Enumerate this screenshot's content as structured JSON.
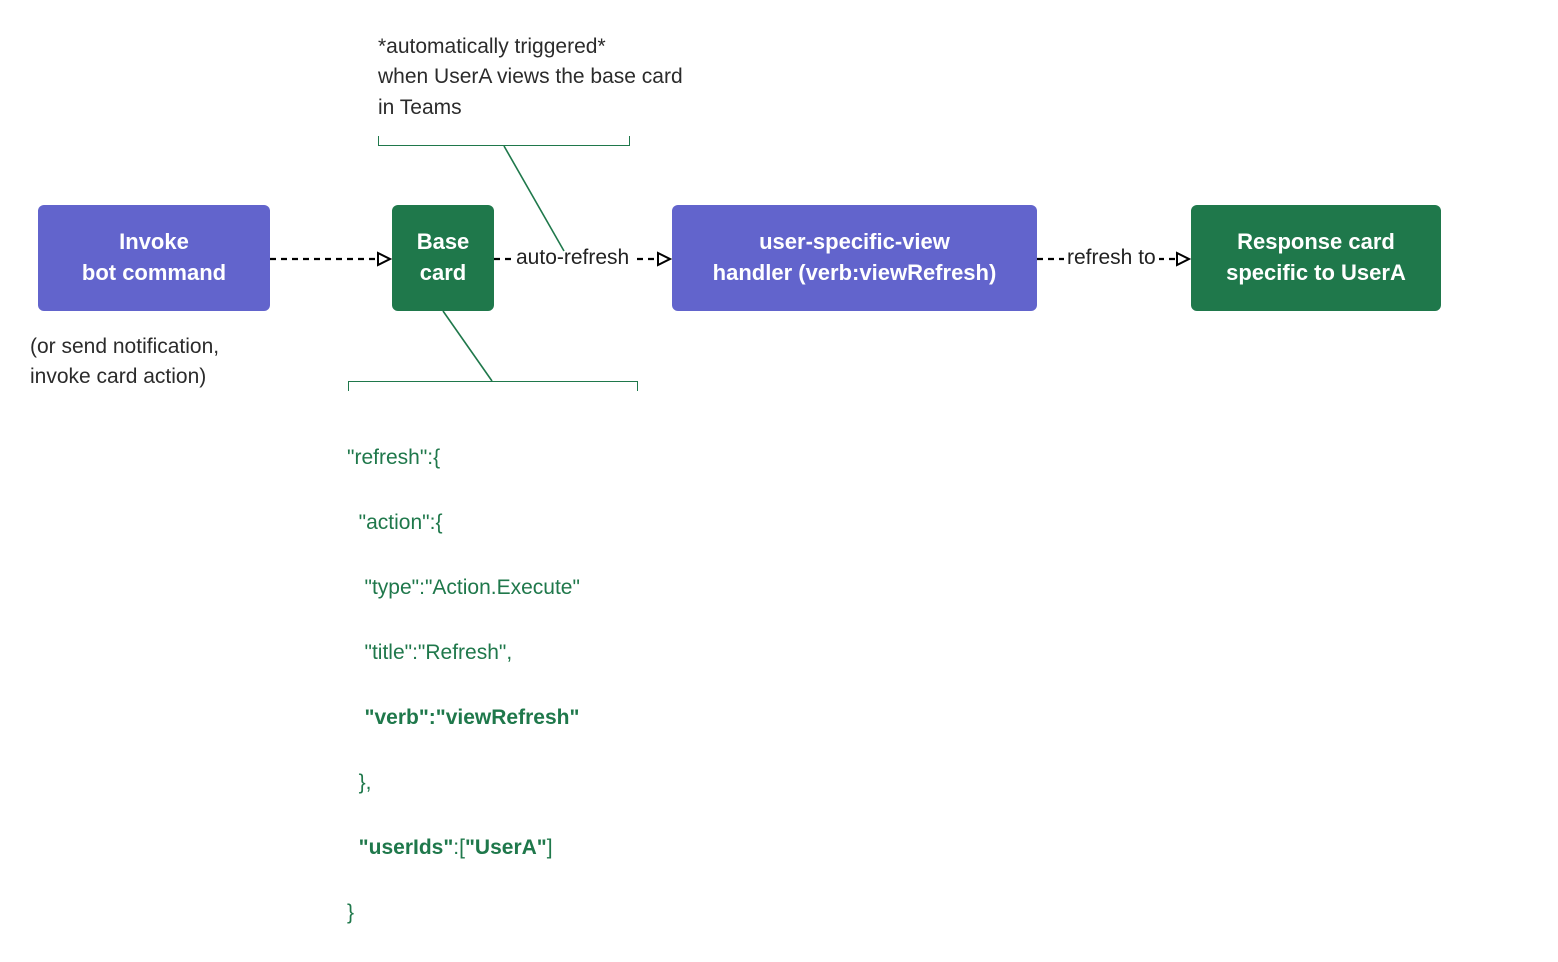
{
  "boxes": {
    "invoke": {
      "line1": "Invoke",
      "line2": "bot command"
    },
    "base": {
      "line1": "Base",
      "line2": "card"
    },
    "handler": {
      "line1": "user-specific-view",
      "line2": "handler (verb:viewRefresh)"
    },
    "response": {
      "line1": "Response card",
      "line2": "specific to UserA"
    }
  },
  "labels": {
    "autoRefresh": "auto-refresh",
    "refreshTo": "refresh to"
  },
  "captions": {
    "top": {
      "line1": "*automatically triggered*",
      "line2": "when UserA views the base card",
      "line3": "in Teams"
    },
    "bottom": {
      "line1": "(or send notification,",
      "line2": "invoke card action)"
    }
  },
  "code": {
    "l1": "\"refresh\":{",
    "l2": "  \"action\":{",
    "l3": "   \"type\":\"Action.Execute\"",
    "l4": "   \"title\":\"Refresh\",",
    "l5a": "   ",
    "l5b": "\"verb\":\"viewRefresh\"",
    "l6": "  },",
    "l7a": "  ",
    "l7b": "\"userIds\"",
    "l7c": ":[",
    "l7d": "\"UserA\"",
    "l7e": "]",
    "l8": "}"
  }
}
